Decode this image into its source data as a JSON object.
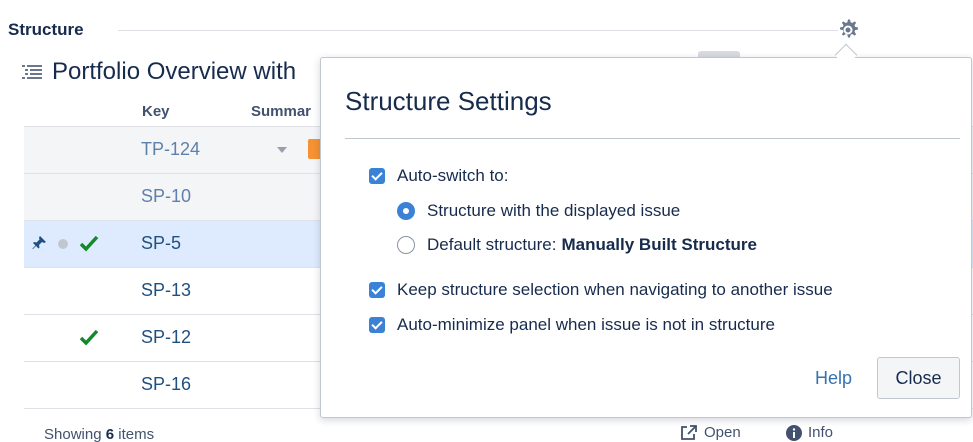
{
  "header": {
    "title": "Structure",
    "settings_icon": "gear-icon"
  },
  "structure": {
    "title": "Portfolio Overview with",
    "icon": "list-icon"
  },
  "grid": {
    "columns": {
      "key": "Key",
      "summary": "Summar"
    },
    "rows": [
      {
        "key": "TP-124"
      },
      {
        "key": "SP-10"
      },
      {
        "key": "SP-5"
      },
      {
        "key": "SP-13"
      },
      {
        "key": "SP-12"
      },
      {
        "key": "SP-16"
      }
    ]
  },
  "footer": {
    "showing_prefix": "Showing ",
    "count": "6",
    "showing_suffix": " items",
    "open_label": "Open",
    "info_label": "Info"
  },
  "popup": {
    "title": "Structure Settings",
    "auto_switch_label": "Auto-switch to:",
    "radio_displayed_label": "Structure with the displayed issue",
    "radio_default_label": "Default structure:",
    "radio_default_value": "Manually Built Structure",
    "keep_selection_label": "Keep structure selection when navigating to another issue",
    "auto_minimize_label": "Auto-minimize panel when issue is not in structure",
    "help_label": "Help",
    "close_label": "Close"
  },
  "colors": {
    "accent": "#3b82d6",
    "link": "#3572b0",
    "selected_row": "#deebff",
    "check_green": "#14892c",
    "pin_blue": "#205081"
  }
}
